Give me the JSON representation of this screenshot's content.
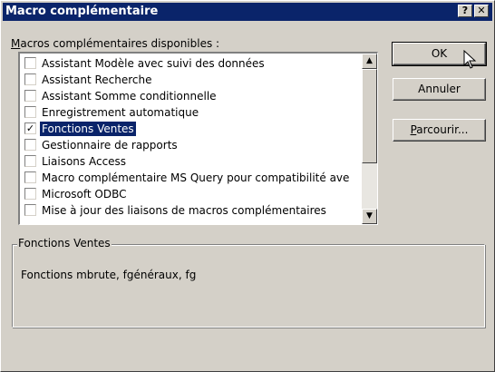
{
  "window": {
    "title": "Macro complémentaire",
    "help_glyph": "?",
    "close_glyph": "✕"
  },
  "list": {
    "label_accel": "M",
    "label_rest": "acros complémentaires disponibles :",
    "items": [
      {
        "label": "Assistant Modèle avec suivi des données",
        "checked": false
      },
      {
        "label": "Assistant Recherche",
        "checked": false
      },
      {
        "label": "Assistant Somme conditionnelle",
        "checked": false
      },
      {
        "label": "Enregistrement automatique",
        "checked": false
      },
      {
        "label": "Fonctions Ventes",
        "checked": true,
        "selected": true
      },
      {
        "label": "Gestionnaire de rapports",
        "checked": false
      },
      {
        "label": "Liaisons Access",
        "checked": false
      },
      {
        "label": "Macro complémentaire MS Query pour compatibilité ave",
        "checked": false
      },
      {
        "label": "Microsoft ODBC",
        "checked": false
      },
      {
        "label": "Mise à jour des liaisons de macros complémentaires",
        "checked": false
      }
    ],
    "scroll_up_glyph": "▲",
    "scroll_down_glyph": "▼"
  },
  "buttons": {
    "ok": "OK",
    "cancel": "Annuler",
    "browse_accel": "P",
    "browse_rest": "arcourir..."
  },
  "description": {
    "title": "Fonctions Ventes",
    "text": "Fonctions mbrute, fgénéraux, fg"
  }
}
